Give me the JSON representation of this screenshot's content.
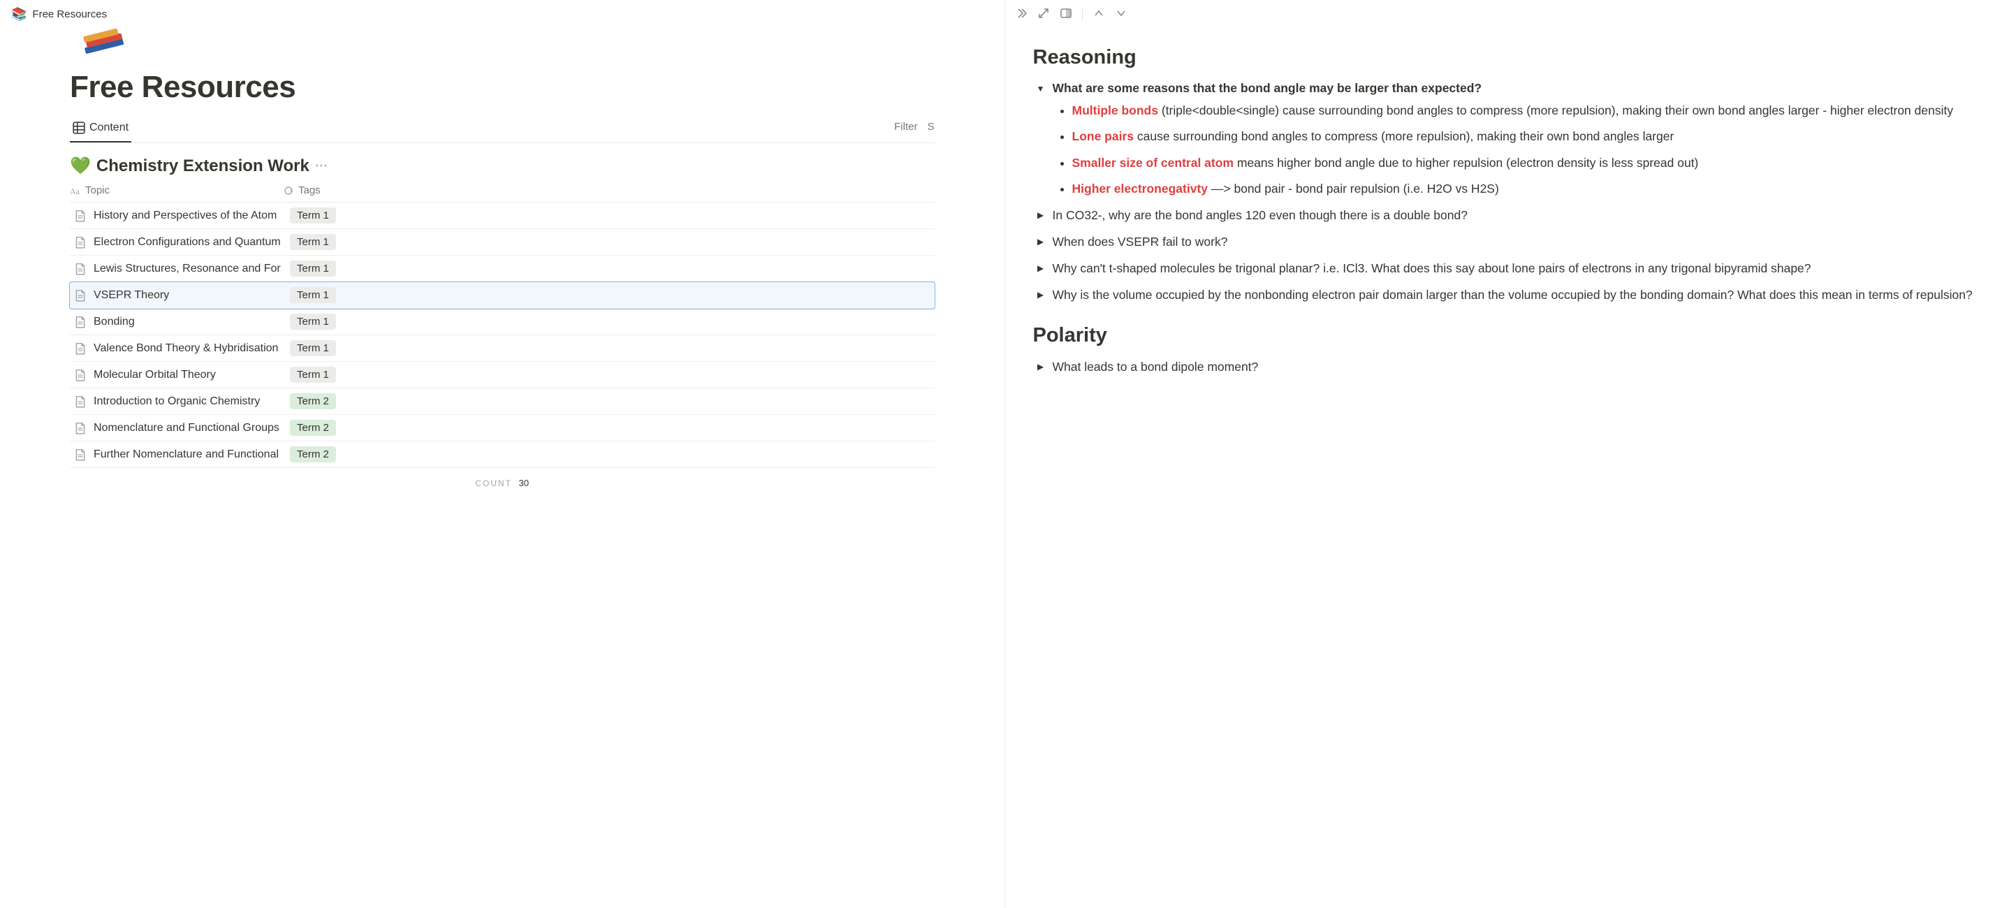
{
  "breadcrumb": {
    "emoji": "📚",
    "title": "Free Resources"
  },
  "page": {
    "title": "Free Resources"
  },
  "view": {
    "tab_label": "Content",
    "filter": "Filter",
    "s": "S"
  },
  "group": {
    "emoji": "💚",
    "title": "Chemistry Extension Work"
  },
  "columns": {
    "topic": "Topic",
    "tags": "Tags"
  },
  "rows": [
    {
      "title": "History and Perspectives of the Atom",
      "tag": "Term 1",
      "tagClass": "tag-term1",
      "selected": false
    },
    {
      "title": "Electron Configurations and Quantum",
      "tag": "Term 1",
      "tagClass": "tag-term1",
      "selected": false
    },
    {
      "title": "Lewis Structures, Resonance and For",
      "tag": "Term 1",
      "tagClass": "tag-term1",
      "selected": false
    },
    {
      "title": "VSEPR Theory",
      "tag": "Term 1",
      "tagClass": "tag-term1",
      "selected": true
    },
    {
      "title": "Bonding",
      "tag": "Term 1",
      "tagClass": "tag-term1",
      "selected": false
    },
    {
      "title": "Valence Bond Theory & Hybridisation",
      "tag": "Term 1",
      "tagClass": "tag-term1",
      "selected": false
    },
    {
      "title": "Molecular Orbital Theory",
      "tag": "Term 1",
      "tagClass": "tag-term1",
      "selected": false
    },
    {
      "title": "Introduction to Organic Chemistry",
      "tag": "Term 2",
      "tagClass": "tag-term2",
      "selected": false
    },
    {
      "title": "Nomenclature and Functional Groups",
      "tag": "Term 2",
      "tagClass": "tag-term2",
      "selected": false
    },
    {
      "title": "Further Nomenclature and Functional",
      "tag": "Term 2",
      "tagClass": "tag-term2",
      "selected": false
    }
  ],
  "count": {
    "label": "COUNT",
    "value": "30"
  },
  "detail": {
    "h_reasoning": "Reasoning",
    "q1_title": "What are some reasons that the bond angle may be larger than expected?",
    "q1_bullets": [
      {
        "kw": "Multiple bonds",
        "rest": " (triple<double<single) cause surrounding bond angles to compress (more repulsion), making their own bond angles larger - higher electron density"
      },
      {
        "kw": "Lone pairs",
        "rest": " cause surrounding bond angles to compress (more repulsion), making their own bond angles larger"
      },
      {
        "kw": "Smaller size of central atom",
        "rest": " means higher bond angle due to higher repulsion (electron density is less spread out)"
      },
      {
        "kw": "Higher electronegativty",
        "rest": " —> bond pair - bond pair repulsion (i.e. H2O vs H2S)"
      }
    ],
    "q2": "In CO32-, why are the bond angles 120 even though there is a double bond?",
    "q3": "When does VSEPR fail to work?",
    "q4": "Why can't t-shaped molecules be trigonal planar? i.e. ICl3. What does this say about lone pairs of electrons in any trigonal bipyramid shape?",
    "q5": "Why is the volume occupied by the nonbonding electron pair domain larger than the volume occupied by the bonding domain? What does this mean in terms of repulsion?",
    "h_polarity": "Polarity",
    "p1": "What leads to a bond dipole moment?"
  }
}
